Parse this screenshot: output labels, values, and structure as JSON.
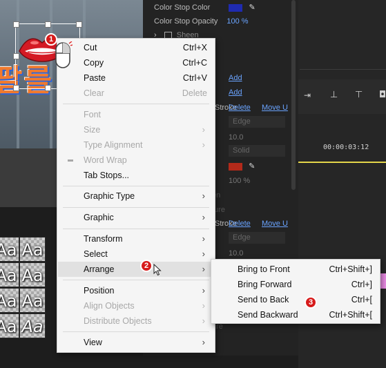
{
  "properties": {
    "color_stop_color_label": "Color Stop Color",
    "color_stop_opacity_label": "Color Stop Opacity",
    "color_stop_opacity_value": "100 %",
    "sheen_label": "Sheen",
    "add_label_1": "Add",
    "add_label_2": "Add",
    "stroke_label_1": "Stroke",
    "delete_label_1": "Delete",
    "move_label_1": "Move U",
    "edge_label": "Edge",
    "value_10_a": "10.0",
    "solid_label": "Solid",
    "opacity_value": "100 %",
    "en_label": "en",
    "ture_label": "ture",
    "stroke_label_2": "Stroke",
    "delete_label_2": "Delete",
    "move_label_2": "Move U",
    "edge_label_2": "Edge",
    "value_10_b": "10.0",
    "ure_label": "ure",
    "swatch_blue": "#1f2bb0",
    "swatch_red": "#b32a1a"
  },
  "timeline": {
    "timecode": "00:00:03:12"
  },
  "preview": {
    "text_fragment": "팔를"
  },
  "effects_grid": {
    "cells": [
      "Aa",
      "Aa",
      "Aa",
      "Aa",
      "Aa",
      "Aa",
      "Aa",
      "Aa"
    ]
  },
  "badges": {
    "b1": "1",
    "b2": "2",
    "b3": "3"
  },
  "context_menu": {
    "cut": {
      "label": "Cut",
      "shortcut": "Ctrl+X"
    },
    "copy": {
      "label": "Copy",
      "shortcut": "Ctrl+C"
    },
    "paste": {
      "label": "Paste",
      "shortcut": "Ctrl+V"
    },
    "clear": {
      "label": "Clear",
      "shortcut": "Delete"
    },
    "font": {
      "label": "Font"
    },
    "size": {
      "label": "Size"
    },
    "type_alignment": {
      "label": "Type Alignment"
    },
    "word_wrap": {
      "label": "Word Wrap"
    },
    "tab_stops": {
      "label": "Tab Stops..."
    },
    "graphic_type": {
      "label": "Graphic Type"
    },
    "graphic": {
      "label": "Graphic"
    },
    "transform": {
      "label": "Transform"
    },
    "select": {
      "label": "Select"
    },
    "arrange": {
      "label": "Arrange"
    },
    "position": {
      "label": "Position"
    },
    "align_objects": {
      "label": "Align Objects"
    },
    "distribute_objects": {
      "label": "Distribute Objects"
    },
    "view": {
      "label": "View"
    }
  },
  "arrange_submenu": {
    "bring_to_front": {
      "label": "Bring to Front",
      "shortcut": "Ctrl+Shift+]"
    },
    "bring_forward": {
      "label": "Bring Forward",
      "shortcut": "Ctrl+]"
    },
    "send_to_back": {
      "label": "Send to Back",
      "shortcut": "Ctrl+["
    },
    "send_backward": {
      "label": "Send Backward",
      "shortcut": "Ctrl+Shift+["
    }
  }
}
